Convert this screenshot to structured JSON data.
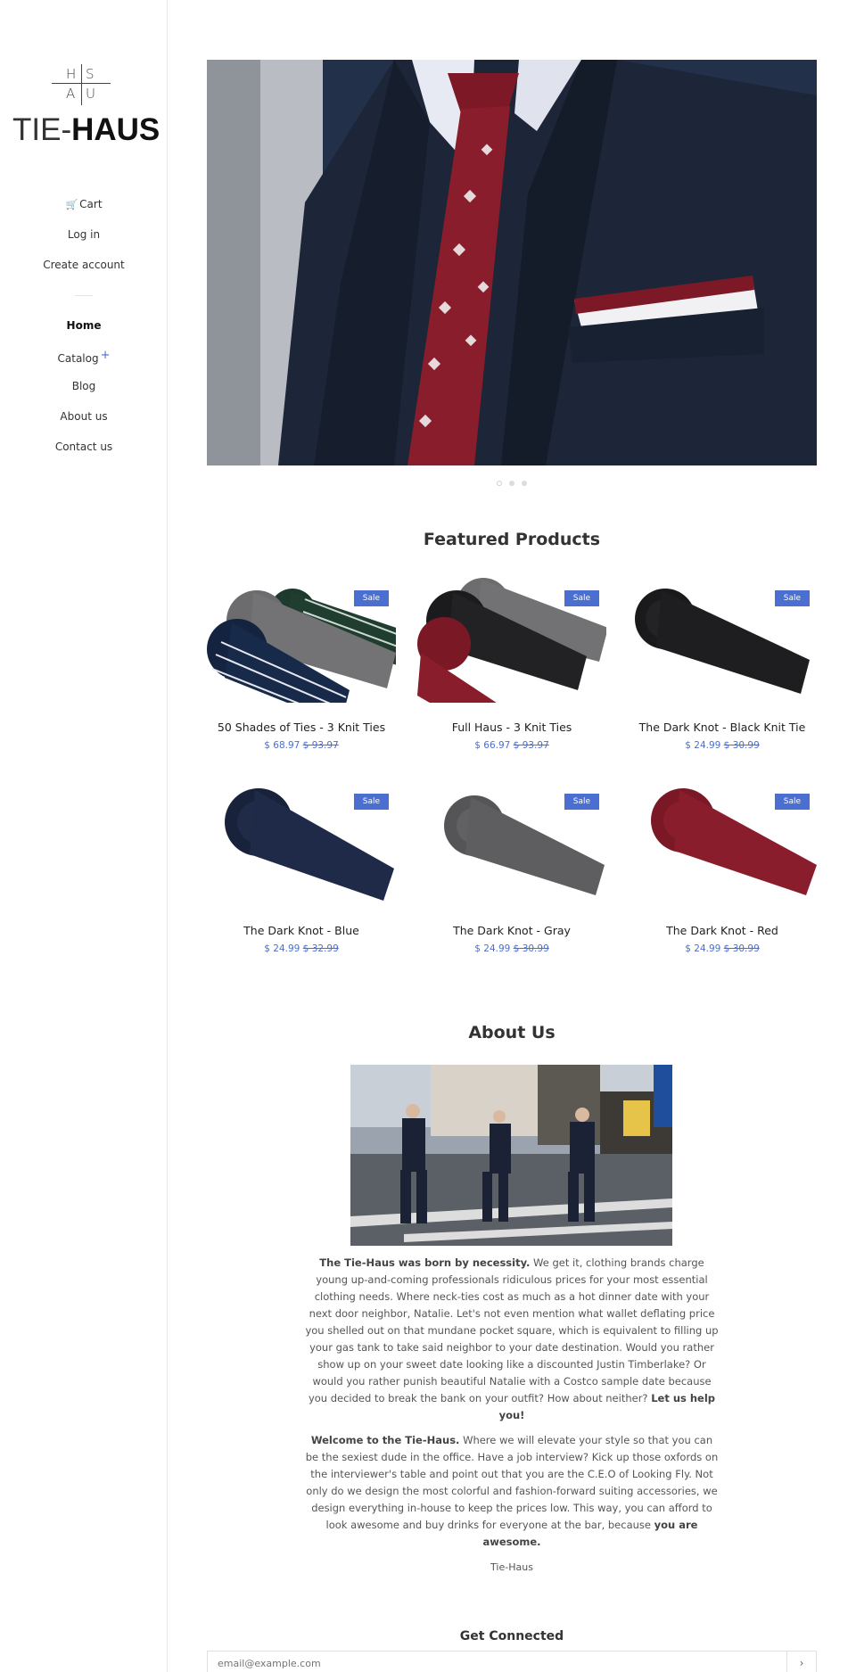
{
  "brand": {
    "mark_letters": [
      "H",
      "S",
      "A",
      "U"
    ],
    "word_light": "TIE-",
    "word_bold": "HAUS"
  },
  "account_nav": {
    "cart": "Cart",
    "login": "Log in",
    "create_account": "Create account"
  },
  "main_nav": {
    "items": [
      "Home",
      "Catalog",
      "Blog",
      "About us",
      "Contact us"
    ],
    "active": "Home",
    "catalog_expand": "+"
  },
  "hero": {
    "slide_count": 3,
    "active_slide": 1
  },
  "featured": {
    "title": "Featured Products",
    "products": [
      {
        "name": "50 Shades of Ties - 3 Knit Ties",
        "price": "$ 68.97",
        "was": "$ 93.97",
        "badge": "Sale"
      },
      {
        "name": "Full Haus - 3 Knit Ties",
        "price": "$ 66.97",
        "was": "$ 93.97",
        "badge": "Sale"
      },
      {
        "name": "The Dark Knot - Black Knit Tie",
        "price": "$ 24.99",
        "was": "$ 30.99",
        "badge": "Sale"
      },
      {
        "name": "The Dark Knot - Blue",
        "price": "$ 24.99",
        "was": "$ 32.99",
        "badge": "Sale"
      },
      {
        "name": "The Dark Knot - Gray",
        "price": "$ 24.99",
        "was": "$ 30.99",
        "badge": "Sale"
      },
      {
        "name": "The Dark Knot - Red",
        "price": "$ 24.99",
        "was": "$ 30.99",
        "badge": "Sale"
      }
    ]
  },
  "about": {
    "title": "About Us",
    "p1_lead": "The Tie-Haus was born by necessity.",
    "p1_body": " We get it, clothing brands charge young up-and-coming professionals ridiculous prices for your most essential clothing needs.  Where neck-ties cost as much as a hot dinner date with your next door neighbor, Natalie. Let's not even mention what wallet deflating price you shelled out on that mundane pocket square, which is equivalent to filling up your gas tank to take said neighbor to your date destination. Would you rather show up on your sweet date looking like a discounted Justin Timberlake? Or would you rather punish beautiful Natalie with a Costco sample date because you decided to break the bank on your outfit? How about neither? ",
    "p1_tail": "Let us help you!",
    "p2_lead": "Welcome to the Tie-Haus.",
    "p2_body": "  Where we will elevate your style so that you can be the sexiest dude in the office.  Have a job interview? Kick up those oxfords on the interviewer's table and point out that you are the C.E.O of Looking Fly.  Not only do we design the most colorful and fashion-forward suiting accessories, we design everything in-house to keep the prices low.  This way, you can afford to look awesome and buy drinks for everyone at the bar, because ",
    "p2_tail": "you are awesome.",
    "signature": "Tie-Haus"
  },
  "newsletter": {
    "title": "Get Connected",
    "placeholder": "email@example.com",
    "submit_icon": "chevron-right-icon",
    "submit_glyph": "›"
  },
  "colors": {
    "accent": "#4a6fd1",
    "tie_red": "#8a1d2b",
    "suit_navy": "#1c2533"
  }
}
